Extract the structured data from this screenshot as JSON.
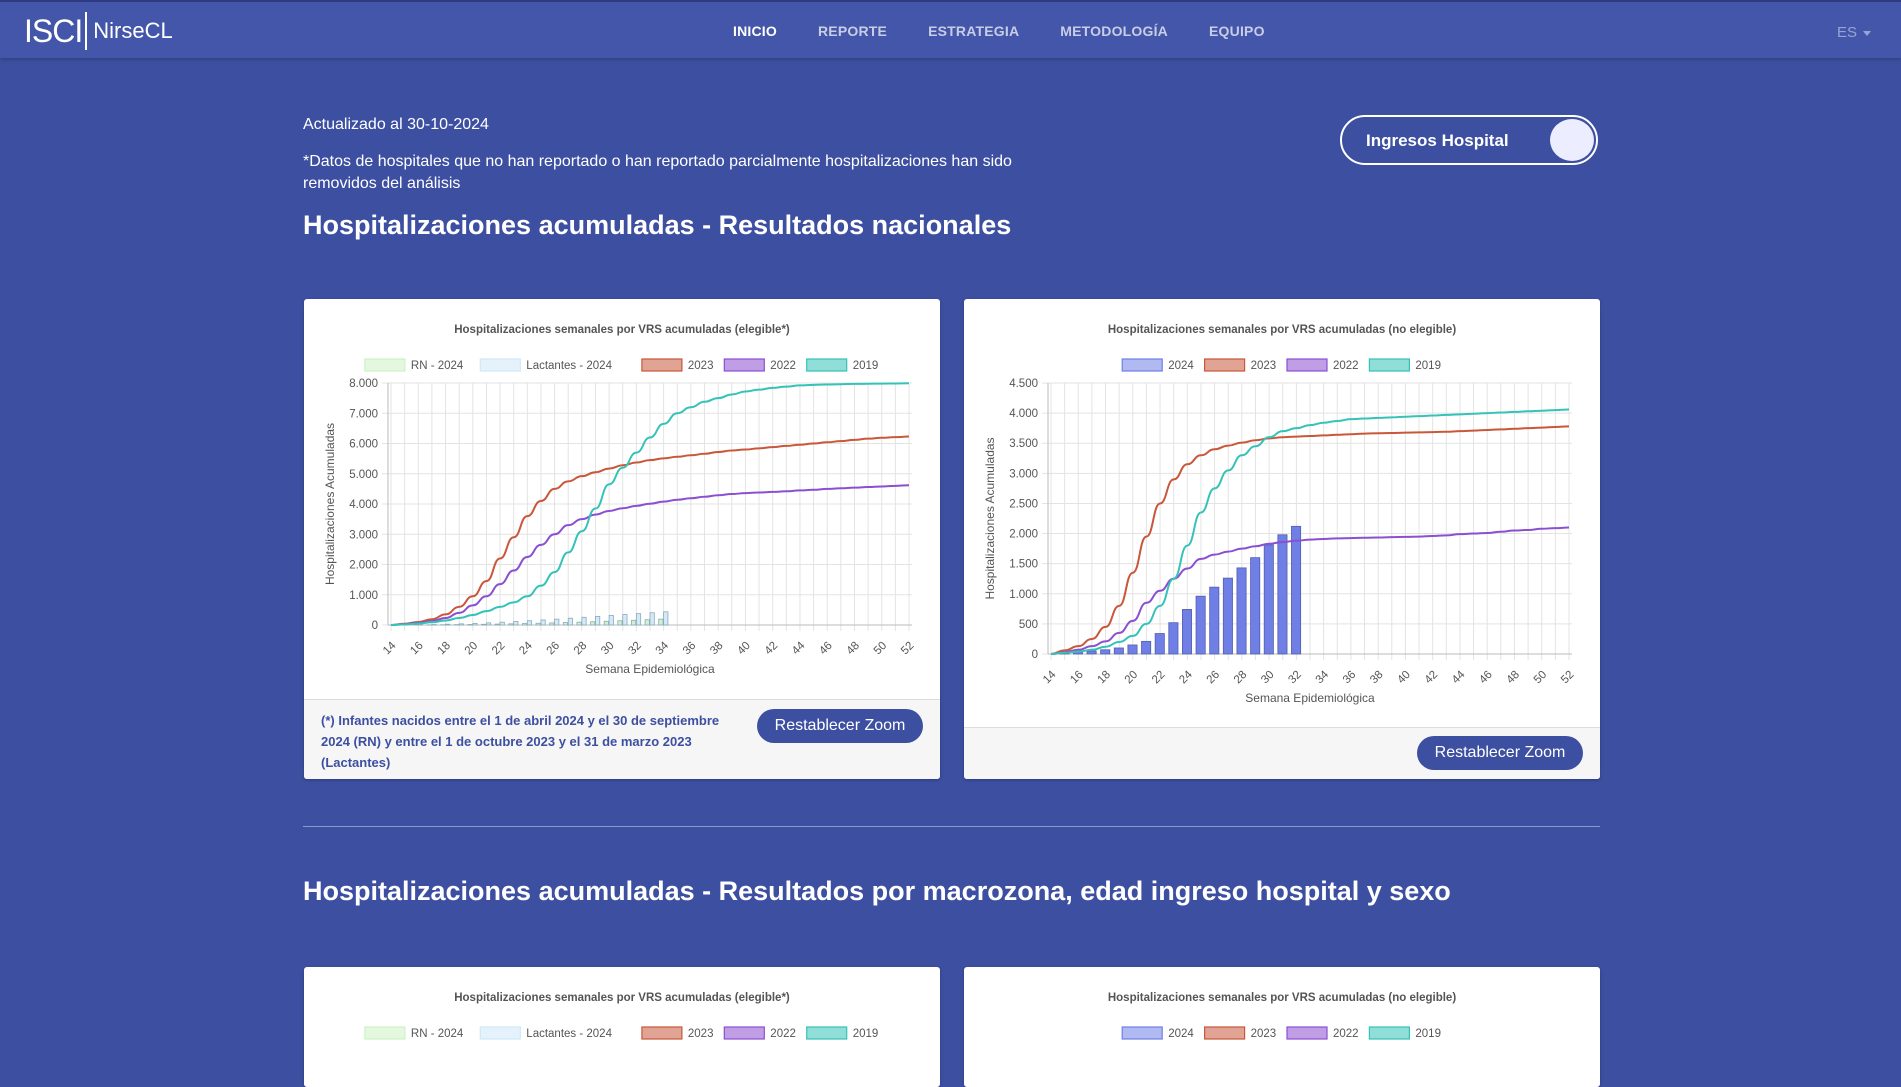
{
  "nav": {
    "logo_main": "ISCI",
    "logo_sub": "NirseCL",
    "links": [
      {
        "label": "INICIO",
        "active": true
      },
      {
        "label": "REPORTE",
        "active": false
      },
      {
        "label": "ESTRATEGIA",
        "active": false
      },
      {
        "label": "METODOLOGÍA",
        "active": false
      },
      {
        "label": "EQUIPO",
        "active": false
      }
    ],
    "language": "ES"
  },
  "page": {
    "updated": "Actualizado al 30-10-2024",
    "disclaimer": "*Datos de hospitales que no han reportado o han reportado parcialmente hospitalizaciones han sido removidos del análisis",
    "title_national": "Hospitalizaciones acumuladas - Resultados nacionales",
    "title_macrozone": "Hospitalizaciones acumuladas - Resultados por macrozona, edad ingreso hospital y sexo",
    "toggle_label": "Ingresos Hospital"
  },
  "colors": {
    "rn2024": "#ccf2c4",
    "lact2024": "#cfe8f7",
    "y2023": "#c9573a",
    "y2022": "#8b4fd1",
    "y2019": "#35c2b8",
    "bar2024": "#6f7fe6"
  },
  "cards": {
    "elegible": {
      "zoom_button": "Restablecer Zoom",
      "footnote": "(*) Infantes nacidos entre el 1 de abril 2024 y el 30 de septiembre 2024 (RN) y entre el 1 de octubre 2023 y el 31 de marzo 2023 (Lactantes)"
    },
    "no_elegible": {
      "zoom_button": "Restablecer Zoom"
    }
  },
  "chart_data": [
    {
      "type": "line",
      "title": "Hospitalizaciones semanales por VRS acumuladas (elegible*)",
      "xlabel": "Semana Epidemiológica",
      "ylabel": "Hospitalizaciones Acumuladas",
      "ylim": [
        0,
        8000
      ],
      "yticks": [
        "0",
        "1.000",
        "2.000",
        "3.000",
        "4.000",
        "5.000",
        "6.000",
        "7.000",
        "8.000"
      ],
      "xticks": [
        "14",
        "16",
        "18",
        "20",
        "22",
        "24",
        "26",
        "28",
        "30",
        "32",
        "34",
        "36",
        "38",
        "40",
        "42",
        "44",
        "46",
        "48",
        "50",
        "52"
      ],
      "x": [
        14,
        15,
        16,
        17,
        18,
        19,
        20,
        21,
        22,
        23,
        24,
        25,
        26,
        27,
        28,
        29,
        30,
        31,
        32,
        33,
        34,
        35,
        36,
        37,
        38,
        39,
        40,
        41,
        42,
        43,
        44,
        45,
        46,
        47,
        48,
        49,
        50,
        51,
        52
      ],
      "legend_position": "top",
      "grid": true,
      "series": [
        {
          "name": "RN - 2024",
          "kind": "bar",
          "color_key": "rn2024",
          "values": [
            0,
            2,
            4,
            6,
            9,
            13,
            18,
            24,
            31,
            39,
            48,
            58,
            69,
            81,
            94,
            108,
            123,
            139,
            156,
            174,
            193
          ]
        },
        {
          "name": "Lactantes - 2024",
          "kind": "bar",
          "color_key": "lact2024",
          "values": [
            1,
            4,
            9,
            16,
            26,
            38,
            53,
            71,
            92,
            115,
            140,
            167,
            195,
            225,
            255,
            285,
            315,
            345,
            375,
            405,
            435
          ]
        },
        {
          "name": "2023",
          "kind": "line",
          "color_key": "y2023",
          "values": [
            0,
            40,
            100,
            190,
            350,
            600,
            950,
            1450,
            2200,
            2900,
            3600,
            4100,
            4500,
            4750,
            4920,
            5050,
            5170,
            5280,
            5370,
            5450,
            5510,
            5560,
            5610,
            5660,
            5720,
            5770,
            5800,
            5840,
            5880,
            5920,
            5960,
            6000,
            6040,
            6080,
            6120,
            6160,
            6190,
            6210,
            6230
          ]
        },
        {
          "name": "2022",
          "kind": "line",
          "color_key": "y2022",
          "values": [
            0,
            30,
            70,
            130,
            230,
            400,
            650,
            950,
            1350,
            1800,
            2250,
            2650,
            3000,
            3300,
            3500,
            3650,
            3770,
            3860,
            3940,
            4010,
            4080,
            4140,
            4190,
            4240,
            4290,
            4330,
            4360,
            4380,
            4400,
            4420,
            4450,
            4470,
            4500,
            4520,
            4540,
            4560,
            4580,
            4600,
            4620
          ]
        },
        {
          "name": "2019",
          "kind": "line",
          "color_key": "y2019",
          "values": [
            0,
            20,
            50,
            90,
            150,
            230,
            330,
            460,
            600,
            750,
            950,
            1300,
            1750,
            2400,
            3100,
            3850,
            4650,
            5200,
            5700,
            6200,
            6650,
            7000,
            7200,
            7380,
            7500,
            7620,
            7720,
            7780,
            7840,
            7880,
            7920,
            7940,
            7950,
            7960,
            7970,
            7975,
            7980,
            7985,
            7990
          ]
        }
      ]
    },
    {
      "type": "line",
      "title": "Hospitalizaciones semanales por VRS acumuladas (no elegible)",
      "xlabel": "Semana Epidemiológica",
      "ylabel": "Hospitalizaciones Acumuladas",
      "ylim": [
        0,
        4500
      ],
      "yticks": [
        "0",
        "500",
        "1.000",
        "1.500",
        "2.000",
        "2.500",
        "3.000",
        "3.500",
        "4.000",
        "4.500"
      ],
      "xticks": [
        "14",
        "16",
        "18",
        "20",
        "22",
        "24",
        "26",
        "28",
        "30",
        "32",
        "34",
        "36",
        "38",
        "40",
        "42",
        "44",
        "46",
        "48",
        "50",
        "52"
      ],
      "x": [
        14,
        15,
        16,
        17,
        18,
        19,
        20,
        21,
        22,
        23,
        24,
        25,
        26,
        27,
        28,
        29,
        30,
        31,
        32,
        33,
        34,
        35,
        36,
        37,
        38,
        39,
        40,
        41,
        42,
        43,
        44,
        45,
        46,
        47,
        48,
        49,
        50,
        51,
        52
      ],
      "legend_position": "top",
      "grid": true,
      "series": [
        {
          "name": "2024",
          "kind": "bar",
          "color_key": "bar2024",
          "values": [
            0,
            10,
            30,
            50,
            70,
            100,
            150,
            210,
            340,
            520,
            740,
            960,
            1110,
            1260,
            1430,
            1600,
            1810,
            1980,
            2120
          ]
        },
        {
          "name": "2023",
          "kind": "line",
          "color_key": "y2023",
          "values": [
            0,
            60,
            130,
            250,
            450,
            800,
            1350,
            1950,
            2500,
            2900,
            3150,
            3300,
            3400,
            3460,
            3510,
            3550,
            3580,
            3600,
            3610,
            3620,
            3630,
            3640,
            3650,
            3660,
            3665,
            3670,
            3675,
            3680,
            3685,
            3690,
            3700,
            3710,
            3720,
            3730,
            3740,
            3750,
            3760,
            3770,
            3780
          ]
        },
        {
          "name": "2022",
          "kind": "line",
          "color_key": "y2022",
          "values": [
            0,
            30,
            70,
            130,
            210,
            350,
            550,
            850,
            1050,
            1250,
            1420,
            1580,
            1650,
            1700,
            1750,
            1790,
            1830,
            1860,
            1880,
            1900,
            1910,
            1920,
            1925,
            1930,
            1935,
            1940,
            1945,
            1950,
            1960,
            1970,
            1990,
            2000,
            2010,
            2030,
            2050,
            2060,
            2080,
            2090,
            2100
          ]
        },
        {
          "name": "2019",
          "kind": "line",
          "color_key": "y2019",
          "values": [
            0,
            20,
            40,
            70,
            120,
            200,
            300,
            500,
            800,
            1250,
            1800,
            2350,
            2750,
            3050,
            3300,
            3450,
            3600,
            3700,
            3750,
            3800,
            3840,
            3870,
            3900,
            3910,
            3920,
            3930,
            3940,
            3950,
            3960,
            3970,
            3980,
            3990,
            4000,
            4010,
            4020,
            4030,
            4040,
            4050,
            4060
          ]
        }
      ]
    },
    {
      "type": "line",
      "title": "Hospitalizaciones semanales por VRS acumuladas (elegible*)",
      "legend_position": "top",
      "series": [
        {
          "name": "RN - 2024",
          "kind": "bar",
          "color_key": "rn2024"
        },
        {
          "name": "Lactantes - 2024",
          "kind": "bar",
          "color_key": "lact2024"
        },
        {
          "name": "2023",
          "kind": "line",
          "color_key": "y2023"
        },
        {
          "name": "2022",
          "kind": "line",
          "color_key": "y2022"
        },
        {
          "name": "2019",
          "kind": "line",
          "color_key": "y2019"
        }
      ]
    },
    {
      "type": "line",
      "title": "Hospitalizaciones semanales por VRS acumuladas (no elegible)",
      "legend_position": "top",
      "series": [
        {
          "name": "2024",
          "kind": "bar",
          "color_key": "bar2024"
        },
        {
          "name": "2023",
          "kind": "line",
          "color_key": "y2023"
        },
        {
          "name": "2022",
          "kind": "line",
          "color_key": "y2022"
        },
        {
          "name": "2019",
          "kind": "line",
          "color_key": "y2019"
        }
      ]
    }
  ]
}
